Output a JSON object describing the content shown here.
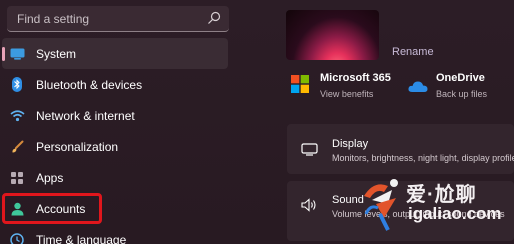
{
  "search": {
    "placeholder": "Find a setting"
  },
  "nav": {
    "items": [
      {
        "label": "System",
        "icon": "monitor-icon"
      },
      {
        "label": "Bluetooth & devices",
        "icon": "bluetooth-icon"
      },
      {
        "label": "Network & internet",
        "icon": "wifi-icon"
      },
      {
        "label": "Personalization",
        "icon": "brush-icon"
      },
      {
        "label": "Apps",
        "icon": "apps-icon"
      },
      {
        "label": "Accounts",
        "icon": "person-icon"
      },
      {
        "label": "Time & language",
        "icon": "clock-icon"
      }
    ]
  },
  "profile": {
    "rename": "Rename"
  },
  "apps": [
    {
      "name": "Microsoft 365",
      "sub": "View benefits"
    },
    {
      "name": "OneDrive",
      "sub": "Back up files"
    }
  ],
  "cards": [
    {
      "title": "Display",
      "sub": "Monitors, brightness, night light, display profile"
    },
    {
      "title": "Sound",
      "sub": "Volume levels, output, input, sound devices"
    }
  ],
  "watermark": {
    "text": "爱·尬聊",
    "url": "igaliao.com"
  },
  "colors": {
    "accent": "#e8a3b8",
    "highlight_box": "#e0161c"
  }
}
